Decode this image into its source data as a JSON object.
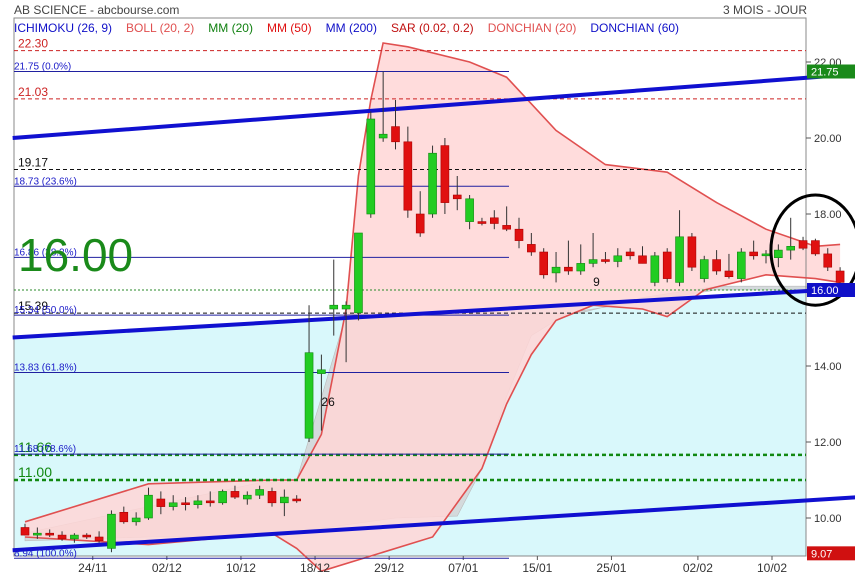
{
  "header": {
    "title": "AB SCIENCE - abcbourse.com",
    "period": "3 MOIS - JOUR"
  },
  "legend": [
    {
      "label": "ICHIMOKU (26, 9)",
      "color": "#1010c8"
    },
    {
      "label": "BOLL (20, 2)",
      "color": "#e05050"
    },
    {
      "label": "MM (20)",
      "color": "#108010"
    },
    {
      "label": "MM (50)",
      "color": "#e01010"
    },
    {
      "label": "MM (200)",
      "color": "#1010c8"
    },
    {
      "label": "SAR (0.02, 0.2)",
      "color": "#c01010"
    },
    {
      "label": "DONCHIAN (20)",
      "color": "#e05050"
    },
    {
      "label": "DONCHIAN (60)",
      "color": "#1010c8"
    }
  ],
  "last_price_big": "16.00",
  "chart_data": {
    "type": "candlestick",
    "y_axis": {
      "min": 8.6,
      "max": 22.3,
      "ticks": [
        10.0,
        12.0,
        14.0,
        16.0,
        18.0,
        20.0,
        22.0
      ],
      "tick_labels": [
        "10.00",
        "12.00",
        "14.00",
        "16.00",
        "18.00",
        "20.00",
        "22.00"
      ],
      "position": "right"
    },
    "x_tick_labels": [
      "24/11",
      "02/12",
      "10/12",
      "18/12",
      "29/12",
      "07/01",
      "15/01",
      "25/01",
      "02/02",
      "10/02"
    ],
    "price_badges": [
      {
        "label": "21.75",
        "value": 21.75,
        "color": "#1a8a1a"
      },
      {
        "label": "16.00",
        "value": 16.0,
        "color": "#1010c8"
      },
      {
        "label": "9.07",
        "value": 9.07,
        "color": "#d01010"
      }
    ],
    "candles": [
      {
        "date": "20/11",
        "open": 9.75,
        "high": 9.85,
        "low": 9.55,
        "close": 9.55
      },
      {
        "date": "21/11",
        "open": 9.55,
        "high": 9.75,
        "low": 9.45,
        "close": 9.6
      },
      {
        "date": "22/11",
        "open": 9.6,
        "high": 9.7,
        "low": 9.5,
        "close": 9.55
      },
      {
        "date": "23/11",
        "open": 9.55,
        "high": 9.65,
        "low": 9.4,
        "close": 9.45
      },
      {
        "date": "24/11",
        "open": 9.45,
        "high": 9.6,
        "low": 9.35,
        "close": 9.55
      },
      {
        "date": "25/11",
        "open": 9.55,
        "high": 9.6,
        "low": 9.45,
        "close": 9.5
      },
      {
        "date": "28/11",
        "open": 9.5,
        "high": 9.65,
        "low": 9.35,
        "close": 9.4
      },
      {
        "date": "29/11",
        "open": 9.2,
        "high": 10.2,
        "low": 9.1,
        "close": 10.1
      },
      {
        "date": "30/11",
        "open": 10.15,
        "high": 10.3,
        "low": 9.85,
        "close": 9.9
      },
      {
        "date": "01/12",
        "open": 9.9,
        "high": 10.15,
        "low": 9.8,
        "close": 10.0
      },
      {
        "date": "02/12",
        "open": 10.0,
        "high": 10.8,
        "low": 9.95,
        "close": 10.6
      },
      {
        "date": "05/12",
        "open": 10.5,
        "high": 10.7,
        "low": 10.1,
        "close": 10.3
      },
      {
        "date": "06/12",
        "open": 10.3,
        "high": 10.6,
        "low": 10.2,
        "close": 10.4
      },
      {
        "date": "07/12",
        "open": 10.4,
        "high": 10.55,
        "low": 10.2,
        "close": 10.35
      },
      {
        "date": "08/12",
        "open": 10.35,
        "high": 10.6,
        "low": 10.25,
        "close": 10.45
      },
      {
        "date": "09/12",
        "open": 10.45,
        "high": 10.7,
        "low": 10.3,
        "close": 10.4
      },
      {
        "date": "12/12",
        "open": 10.4,
        "high": 10.75,
        "low": 10.35,
        "close": 10.7
      },
      {
        "date": "13/12",
        "open": 10.7,
        "high": 10.85,
        "low": 10.5,
        "close": 10.55
      },
      {
        "date": "14/12",
        "open": 10.5,
        "high": 10.7,
        "low": 10.35,
        "close": 10.6
      },
      {
        "date": "15/12",
        "open": 10.6,
        "high": 10.85,
        "low": 10.5,
        "close": 10.75
      },
      {
        "date": "16/12",
        "open": 10.7,
        "high": 10.8,
        "low": 10.3,
        "close": 10.4
      },
      {
        "date": "19/12",
        "open": 10.4,
        "high": 10.75,
        "low": 10.05,
        "close": 10.55
      },
      {
        "date": "20/12",
        "open": 10.5,
        "high": 10.6,
        "low": 10.4,
        "close": 10.45
      },
      {
        "date": "21/12",
        "open": 12.1,
        "high": 15.6,
        "low": 12.0,
        "close": 14.35
      },
      {
        "date": "22/12",
        "open": 13.8,
        "high": 14.3,
        "low": 12.3,
        "close": 13.9
      },
      {
        "date": "23/12",
        "open": 15.5,
        "high": 16.8,
        "low": 14.8,
        "close": 15.6
      },
      {
        "date": "27/12",
        "open": 15.5,
        "high": 15.7,
        "low": 14.1,
        "close": 15.6
      },
      {
        "date": "28/12",
        "open": 15.4,
        "high": 17.5,
        "low": 15.2,
        "close": 17.5
      },
      {
        "date": "29/12",
        "open": 18.0,
        "high": 20.7,
        "low": 17.9,
        "close": 20.5
      },
      {
        "date": "30/12",
        "open": 20.0,
        "high": 21.75,
        "low": 19.9,
        "close": 20.1
      },
      {
        "date": "02/01",
        "open": 20.3,
        "high": 21.0,
        "low": 19.7,
        "close": 19.9
      },
      {
        "date": "03/01",
        "open": 19.9,
        "high": 20.3,
        "low": 17.9,
        "close": 18.1
      },
      {
        "date": "04/01",
        "open": 18.0,
        "high": 18.6,
        "low": 17.4,
        "close": 17.5
      },
      {
        "date": "05/01",
        "open": 18.0,
        "high": 19.8,
        "low": 17.9,
        "close": 19.6
      },
      {
        "date": "06/01",
        "open": 19.8,
        "high": 20.0,
        "low": 18.0,
        "close": 18.3
      },
      {
        "date": "09/01",
        "open": 18.5,
        "high": 19.0,
        "low": 18.1,
        "close": 18.4
      },
      {
        "date": "10/01",
        "open": 17.8,
        "high": 18.5,
        "low": 17.6,
        "close": 18.4
      },
      {
        "date": "11/01",
        "open": 17.8,
        "high": 17.9,
        "low": 17.7,
        "close": 17.75
      },
      {
        "date": "12/01",
        "open": 17.9,
        "high": 18.1,
        "low": 17.6,
        "close": 17.75
      },
      {
        "date": "13/01",
        "open": 17.7,
        "high": 18.2,
        "low": 17.55,
        "close": 17.6
      },
      {
        "date": "16/01",
        "open": 17.6,
        "high": 17.9,
        "low": 17.1,
        "close": 17.3
      },
      {
        "date": "17/01",
        "open": 17.2,
        "high": 17.5,
        "low": 16.9,
        "close": 17.0
      },
      {
        "date": "18/01",
        "open": 17.0,
        "high": 17.1,
        "low": 16.3,
        "close": 16.4
      },
      {
        "date": "19/01",
        "open": 16.45,
        "high": 17.0,
        "low": 16.2,
        "close": 16.6
      },
      {
        "date": "20/01",
        "open": 16.6,
        "high": 17.3,
        "low": 16.4,
        "close": 16.5
      },
      {
        "date": "23/01",
        "open": 16.5,
        "high": 17.2,
        "low": 16.4,
        "close": 16.7
      },
      {
        "date": "24/01",
        "open": 16.7,
        "high": 17.5,
        "low": 16.6,
        "close": 16.8
      },
      {
        "date": "25/01",
        "open": 16.8,
        "high": 17.0,
        "low": 16.7,
        "close": 16.75
      },
      {
        "date": "26/01",
        "open": 16.75,
        "high": 17.1,
        "low": 16.6,
        "close": 16.9
      },
      {
        "date": "27/01",
        "open": 17.0,
        "high": 17.1,
        "low": 16.8,
        "close": 16.9
      },
      {
        "date": "30/01",
        "open": 16.9,
        "high": 17.15,
        "low": 16.7,
        "close": 16.7
      },
      {
        "date": "31/01",
        "open": 16.2,
        "high": 17.0,
        "low": 16.1,
        "close": 16.9
      },
      {
        "date": "01/02",
        "open": 17.0,
        "high": 17.1,
        "low": 16.2,
        "close": 16.3
      },
      {
        "date": "02/02",
        "open": 16.2,
        "high": 18.1,
        "low": 16.1,
        "close": 17.4
      },
      {
        "date": "03/02",
        "open": 17.4,
        "high": 17.5,
        "low": 16.5,
        "close": 16.6
      },
      {
        "date": "06/02",
        "open": 16.3,
        "high": 16.9,
        "low": 16.2,
        "close": 16.8
      },
      {
        "date": "07/02",
        "open": 16.8,
        "high": 17.05,
        "low": 16.4,
        "close": 16.5
      },
      {
        "date": "08/02",
        "open": 16.5,
        "high": 16.95,
        "low": 16.3,
        "close": 16.35
      },
      {
        "date": "09/02",
        "open": 16.3,
        "high": 17.1,
        "low": 16.2,
        "close": 17.0
      },
      {
        "date": "10/02",
        "open": 17.0,
        "high": 17.3,
        "low": 16.8,
        "close": 16.9
      },
      {
        "date": "13/02",
        "open": 16.9,
        "high": 17.05,
        "low": 16.7,
        "close": 16.95
      },
      {
        "date": "14/02",
        "open": 16.85,
        "high": 17.2,
        "low": 16.6,
        "close": 17.05
      },
      {
        "date": "15/02",
        "open": 17.05,
        "high": 17.9,
        "low": 16.8,
        "close": 17.15
      },
      {
        "date": "16/02",
        "open": 17.3,
        "high": 17.4,
        "low": 17.05,
        "close": 17.1
      },
      {
        "date": "17/02",
        "open": 17.3,
        "high": 17.35,
        "low": 16.9,
        "close": 16.95
      },
      {
        "date": "20/02",
        "open": 16.95,
        "high": 17.1,
        "low": 16.5,
        "close": 16.6
      },
      {
        "date": "21/02",
        "open": 16.5,
        "high": 16.6,
        "low": 16.1,
        "close": 16.2
      }
    ],
    "fibonacci": [
      {
        "label": "21.75 (0.0%)",
        "value": 21.75
      },
      {
        "label": "18.73 (23.6%)",
        "value": 18.73
      },
      {
        "label": "16.86 (38.2%)",
        "value": 16.86
      },
      {
        "label": "15.34 (50.0%)",
        "value": 15.34
      },
      {
        "label": "13.83 (61.8%)",
        "value": 13.83
      },
      {
        "label": "11.68 (78.6%)",
        "value": 11.68
      },
      {
        "label": "8.94 (100.0%)",
        "value": 8.94
      }
    ],
    "dashed_levels": [
      {
        "label": "22.30",
        "value": 22.3,
        "color": "#cc2222"
      },
      {
        "label": "21.03",
        "value": 21.03,
        "color": "#cc2222"
      },
      {
        "label": "19.17",
        "value": 19.17,
        "color": "#111111"
      },
      {
        "label": "15.39",
        "value": 15.39,
        "color": "#111111"
      },
      {
        "label": "11.66",
        "value": 11.66,
        "color": "#118811"
      },
      {
        "label": "11.00",
        "value": 11.0,
        "color": "#118811"
      }
    ],
    "annotations": [
      {
        "text": "26",
        "index": 24,
        "value": 12.95
      },
      {
        "text": "9",
        "index": 46,
        "value": 16.1
      }
    ],
    "trendlines": [
      {
        "name": "upper-channel",
        "from": {
          "index": -1,
          "value": 20.0
        },
        "to": {
          "index": 70,
          "value": 21.75
        }
      },
      {
        "name": "middle-channel",
        "from": {
          "index": -1,
          "value": 14.75
        },
        "to": {
          "index": 70,
          "value": 16.1
        }
      },
      {
        "name": "lower-channel",
        "from": {
          "index": -1,
          "value": 9.15
        },
        "to": {
          "index": 70,
          "value": 10.6
        }
      }
    ],
    "ellipse": {
      "center_index": 64,
      "center_value": 17.05,
      "span_index": 3.6,
      "span_value": 1.45
    },
    "bollinger_upper": [
      [
        0,
        9.9
      ],
      [
        10,
        10.9
      ],
      [
        20,
        11.0
      ],
      [
        22,
        11.0
      ],
      [
        24,
        12.2
      ],
      [
        26,
        15.5
      ],
      [
        27,
        19.0
      ],
      [
        28,
        21.0
      ],
      [
        29,
        22.5
      ],
      [
        31,
        22.4
      ],
      [
        36,
        22.0
      ],
      [
        39,
        21.6
      ],
      [
        43,
        20.2
      ],
      [
        47,
        19.3
      ],
      [
        52,
        19.1
      ],
      [
        56,
        18.3
      ],
      [
        60,
        17.6
      ],
      [
        64,
        17.15
      ],
      [
        66,
        17.2
      ]
    ],
    "bollinger_lower": [
      [
        0,
        9.5
      ],
      [
        10,
        9.3
      ],
      [
        20,
        9.6
      ],
      [
        22,
        9.2
      ],
      [
        24,
        8.6
      ],
      [
        33,
        9.5
      ],
      [
        37,
        11.3
      ],
      [
        39,
        13.0
      ],
      [
        41,
        14.3
      ],
      [
        43,
        15.2
      ],
      [
        46,
        15.6
      ],
      [
        50,
        15.5
      ],
      [
        52,
        15.3
      ],
      [
        55,
        16.0
      ],
      [
        60,
        16.4
      ],
      [
        64,
        16.3
      ],
      [
        66,
        16.2
      ]
    ],
    "cloud_gray_top": [
      [
        0,
        9.6
      ],
      [
        20,
        11.0
      ],
      [
        22,
        11.0
      ],
      [
        26,
        15.35
      ],
      [
        33,
        15.35
      ],
      [
        40,
        15.35
      ],
      [
        45,
        15.4
      ],
      [
        50,
        15.8
      ],
      [
        56,
        16.1
      ],
      [
        62,
        16.1
      ],
      [
        66,
        16.1
      ]
    ],
    "cloud_gray_bottom": [
      [
        0,
        9.4
      ],
      [
        10,
        9.5
      ],
      [
        20,
        9.55
      ],
      [
        30,
        10.0
      ],
      [
        35,
        10.05
      ],
      [
        37,
        11.3
      ],
      [
        39,
        13.2
      ],
      [
        41,
        14.8
      ],
      [
        44,
        15.4
      ],
      [
        50,
        15.7
      ],
      [
        56,
        16.0
      ],
      [
        66,
        16.0
      ]
    ]
  }
}
